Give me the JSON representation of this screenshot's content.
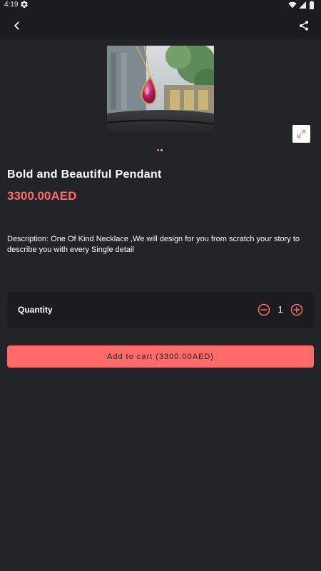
{
  "status_bar": {
    "time": "4:19"
  },
  "icons": {
    "settings": "gear-icon",
    "wifi": "wifi-icon",
    "signal": "signal-icon",
    "battery": "battery-icon",
    "back": "arrow-back-icon",
    "share": "share-icon",
    "expand": "expand-icon",
    "minus": "minus-circle-icon",
    "plus": "plus-circle-icon"
  },
  "colors": {
    "background": "#232427",
    "bar": "#1b1c1e",
    "accent": "#ff6b6b"
  },
  "gallery": {
    "active_index": 0,
    "count": 2
  },
  "product": {
    "title": "Bold and Beautiful Pendant",
    "price": "3300.00AED",
    "description": "Description: One Of Kind Necklace ,We will design for you from scratch your story to describe you with every Single detail"
  },
  "quantity": {
    "label": "Quantity",
    "value": "1"
  },
  "cart": {
    "button_label": "Add to cart (3300.00AED)"
  }
}
